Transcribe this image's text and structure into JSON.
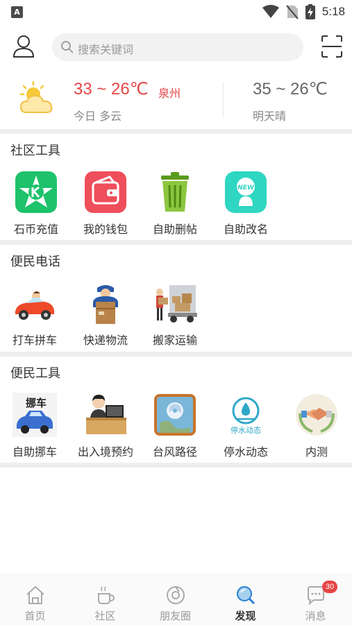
{
  "status_bar": {
    "time": "5:18",
    "app_badge": "A"
  },
  "header": {
    "search_placeholder": "搜索关键词"
  },
  "weather": {
    "today_temp": "33 ~ 26℃",
    "city": "泉州",
    "today_desc": "今日 多云",
    "tomorrow_temp": "35 ~ 26℃",
    "tomorrow_desc": "明天晴"
  },
  "sections": [
    {
      "title": "社区工具",
      "items": [
        {
          "label": "石币充值",
          "icon": "k-coin-icon"
        },
        {
          "label": "我的钱包",
          "icon": "wallet-icon"
        },
        {
          "label": "自助删帖",
          "icon": "trash-icon"
        },
        {
          "label": "自助改名",
          "icon": "new-name-icon"
        }
      ]
    },
    {
      "title": "便民电话",
      "items": [
        {
          "label": "打车拼车",
          "icon": "taxi-icon"
        },
        {
          "label": "快递物流",
          "icon": "courier-icon"
        },
        {
          "label": "搬家运输",
          "icon": "moving-truck-icon"
        }
      ]
    },
    {
      "title": "便民工具",
      "items": [
        {
          "label": "自助挪车",
          "icon": "move-car-icon",
          "icon_text": "挪车"
        },
        {
          "label": "出入境预约",
          "icon": "immigration-icon"
        },
        {
          "label": "台风路径",
          "icon": "typhoon-icon"
        },
        {
          "label": "停水动态",
          "icon": "water-outage-icon",
          "icon_text": "停水动态"
        },
        {
          "label": "内测",
          "icon": "handshake-icon"
        }
      ]
    }
  ],
  "tabbar": {
    "tabs": [
      {
        "label": "首页",
        "icon": "home-icon"
      },
      {
        "label": "社区",
        "icon": "coffee-icon"
      },
      {
        "label": "朋友圈",
        "icon": "moments-icon"
      },
      {
        "label": "发现",
        "icon": "discover-icon",
        "active": true
      },
      {
        "label": "消息",
        "icon": "message-icon",
        "badge": "30"
      }
    ]
  },
  "colors": {
    "accent_red": "#e64545",
    "text_primary": "#333333",
    "text_secondary": "#888888",
    "separator": "#eeeeee"
  }
}
